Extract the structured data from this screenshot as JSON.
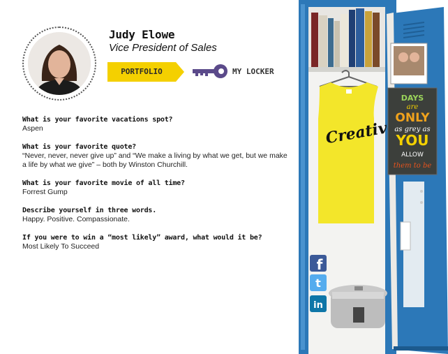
{
  "profile": {
    "name": "Judy Elowe",
    "title": "Vice President of Sales"
  },
  "nav": {
    "portfolio_label": "PORTFOLIO",
    "my_locker_label": "MY LOCKER"
  },
  "qa": [
    {
      "question": "What is your favorite vacations spot?",
      "answer": "Aspen"
    },
    {
      "question": "What is your favorite quote?",
      "answer": "“Never, never, never give up” and “We make a living by what we get, but we make a life by what we give” – both by Winston Churchill."
    },
    {
      "question": "What is your favorite movie of all time?",
      "answer": "Forrest Gump"
    },
    {
      "question": "Describe yourself in three words.",
      "answer": "Happy. Positive. Compassionate."
    },
    {
      "question": "If you were to win a “most likely” award, what would it be?",
      "answer": "Most Likely To Succeed"
    }
  ],
  "locker": {
    "shirt_text": "Creative",
    "poster": {
      "line1": "DAYS",
      "line2": "are",
      "line3": "ONLY",
      "line4": "as grey as",
      "line5": "YOU",
      "line6": "ALLOW",
      "line7": "them to be"
    }
  },
  "social": {
    "facebook_glyph": "f",
    "twitter_glyph": "t",
    "linkedin_glyph": "in"
  },
  "colors": {
    "accent_yellow": "#f4d000",
    "locker_blue": "#2c78b8",
    "key_purple": "#5b4a8a"
  }
}
